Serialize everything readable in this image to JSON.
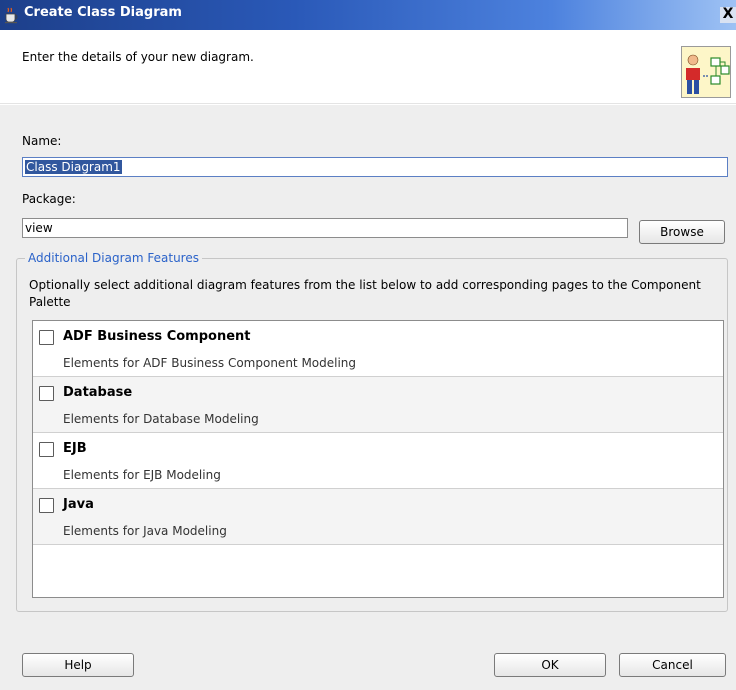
{
  "window": {
    "title": "Create Class Diagram",
    "close_glyph": "X"
  },
  "header": {
    "description": "Enter the details of your new diagram."
  },
  "form": {
    "name_label": "Name:",
    "name_value": "Class Diagram1",
    "package_label": "Package:",
    "package_value": "view",
    "browse_label": "Browse"
  },
  "features": {
    "legend": "Additional Diagram Features",
    "description": "Optionally select additional diagram features from the list below to add corresponding pages to the Component Palette",
    "items": [
      {
        "name": "ADF Business Component",
        "description": "Elements for ADF Business Component Modeling",
        "checked": false
      },
      {
        "name": "Database",
        "description": "Elements for Database Modeling",
        "checked": false
      },
      {
        "name": "EJB",
        "description": "Elements for EJB Modeling",
        "checked": false
      },
      {
        "name": "Java",
        "description": "Elements for Java Modeling",
        "checked": false
      }
    ]
  },
  "buttons": {
    "help": "Help",
    "ok": "OK",
    "cancel": "Cancel"
  },
  "icons": {
    "app": "coffee-cup-icon",
    "header": "class-diagram-icon"
  }
}
